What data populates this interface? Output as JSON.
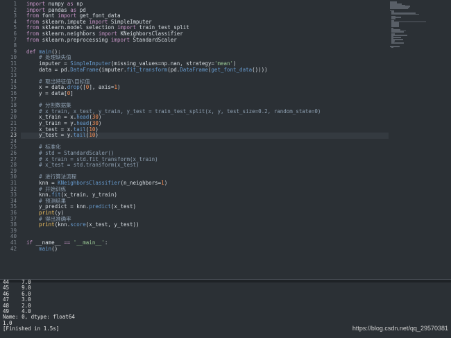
{
  "editor": {
    "current_line": 23,
    "lines": [
      {
        "n": "1",
        "t": [
          {
            "c": "kw",
            "v": "import"
          },
          {
            "v": " numpy "
          },
          {
            "c": "kw",
            "v": "as"
          },
          {
            "v": " np"
          }
        ]
      },
      {
        "n": "2",
        "t": [
          {
            "c": "kw",
            "v": "import"
          },
          {
            "v": " pandas "
          },
          {
            "c": "kw",
            "v": "as"
          },
          {
            "v": " pd"
          }
        ]
      },
      {
        "n": "3",
        "t": [
          {
            "c": "kw",
            "v": "from"
          },
          {
            "v": " font "
          },
          {
            "c": "kw",
            "v": "import"
          },
          {
            "v": " get_font_data"
          }
        ]
      },
      {
        "n": "4",
        "t": [
          {
            "c": "kw",
            "v": "from"
          },
          {
            "v": " sklearn.impute "
          },
          {
            "c": "kw",
            "v": "import"
          },
          {
            "v": " SimpleImputer"
          }
        ]
      },
      {
        "n": "5",
        "t": [
          {
            "c": "kw",
            "v": "from"
          },
          {
            "v": " sklearn.model_selection "
          },
          {
            "c": "kw",
            "v": "import"
          },
          {
            "v": " train_test_split"
          }
        ]
      },
      {
        "n": "6",
        "t": [
          {
            "c": "kw",
            "v": "from"
          },
          {
            "v": " sklearn.neighbors "
          },
          {
            "c": "kw",
            "v": "import"
          },
          {
            "v": " KNeighborsClassifier"
          }
        ]
      },
      {
        "n": "7",
        "t": [
          {
            "c": "kw",
            "v": "from"
          },
          {
            "v": " sklearn.preprocessing "
          },
          {
            "c": "kw",
            "v": "import"
          },
          {
            "v": " StandardScaler"
          }
        ]
      },
      {
        "n": "8",
        "t": []
      },
      {
        "n": "9",
        "t": [
          {
            "c": "kw",
            "v": "def"
          },
          {
            "v": " "
          },
          {
            "c": "fn",
            "v": "main"
          },
          {
            "v": "():"
          }
        ]
      },
      {
        "n": "10",
        "t": [
          {
            "v": "    "
          },
          {
            "c": "cm",
            "v": "# 处理缺失值"
          }
        ]
      },
      {
        "n": "11",
        "t": [
          {
            "v": "    imputer = "
          },
          {
            "c": "fn",
            "v": "SimpleImputer"
          },
          {
            "v": "(missing_values=np.nan, strategy="
          },
          {
            "c": "st",
            "v": "'mean'"
          },
          {
            "v": ")"
          }
        ]
      },
      {
        "n": "12",
        "t": [
          {
            "v": "    data = pd."
          },
          {
            "c": "fn",
            "v": "DataFrame"
          },
          {
            "v": "(imputer."
          },
          {
            "c": "fn",
            "v": "fit_transform"
          },
          {
            "v": "(pd."
          },
          {
            "c": "fn",
            "v": "DataFrame"
          },
          {
            "v": "("
          },
          {
            "c": "fn",
            "v": "get_font_data"
          },
          {
            "v": "())))"
          }
        ]
      },
      {
        "n": "13",
        "t": []
      },
      {
        "n": "14",
        "t": [
          {
            "v": "    "
          },
          {
            "c": "cm",
            "v": "# 取出特征值\\目标值"
          }
        ]
      },
      {
        "n": "15",
        "t": [
          {
            "v": "    x = data."
          },
          {
            "c": "fn",
            "v": "drop"
          },
          {
            "v": "(["
          },
          {
            "c": "nm",
            "v": "0"
          },
          {
            "v": "], axis="
          },
          {
            "c": "nm",
            "v": "1"
          },
          {
            "v": ")"
          }
        ]
      },
      {
        "n": "16",
        "t": [
          {
            "v": "    y = data["
          },
          {
            "c": "nm",
            "v": "0"
          },
          {
            "v": "]"
          }
        ]
      },
      {
        "n": "17",
        "t": []
      },
      {
        "n": "18",
        "t": [
          {
            "v": "    "
          },
          {
            "c": "cm",
            "v": "# 分割数据集"
          }
        ]
      },
      {
        "n": "19",
        "t": [
          {
            "v": "    "
          },
          {
            "c": "cm",
            "v": "# x_train, x_test, y_train, y_test = train_test_split(x, y, test_size=0.2, random_state=0)"
          }
        ]
      },
      {
        "n": "20",
        "t": [
          {
            "v": "    x_train = x."
          },
          {
            "c": "fn",
            "v": "head"
          },
          {
            "v": "("
          },
          {
            "c": "nm",
            "v": "30"
          },
          {
            "v": ")"
          }
        ]
      },
      {
        "n": "21",
        "t": [
          {
            "v": "    y_train = y."
          },
          {
            "c": "fn",
            "v": "head"
          },
          {
            "v": "("
          },
          {
            "c": "nm",
            "v": "30"
          },
          {
            "v": ")"
          }
        ]
      },
      {
        "n": "22",
        "t": [
          {
            "v": "    x_test = x."
          },
          {
            "c": "fn",
            "v": "tail"
          },
          {
            "v": "("
          },
          {
            "c": "nm",
            "v": "10"
          },
          {
            "v": ")"
          }
        ]
      },
      {
        "n": "23",
        "t": [
          {
            "v": "    y_test = y."
          },
          {
            "c": "fn",
            "v": "tail"
          },
          {
            "v": "("
          },
          {
            "c": "nm",
            "v": "10"
          },
          {
            "v": ")"
          }
        ]
      },
      {
        "n": "24",
        "t": []
      },
      {
        "n": "25",
        "t": [
          {
            "v": "    "
          },
          {
            "c": "cm",
            "v": "# 标准化"
          }
        ]
      },
      {
        "n": "26",
        "t": [
          {
            "v": "    "
          },
          {
            "c": "cm",
            "v": "# std = StandardScaler()"
          }
        ]
      },
      {
        "n": "27",
        "t": [
          {
            "v": "    "
          },
          {
            "c": "cm",
            "v": "# x_train = std.fit_transform(x_train)"
          }
        ]
      },
      {
        "n": "28",
        "t": [
          {
            "v": "    "
          },
          {
            "c": "cm",
            "v": "# x_test = std.transform(x_test)"
          }
        ]
      },
      {
        "n": "29",
        "t": []
      },
      {
        "n": "30",
        "t": [
          {
            "v": "    "
          },
          {
            "c": "cm",
            "v": "# 进行算法流程"
          }
        ]
      },
      {
        "n": "31",
        "t": [
          {
            "v": "    knn = "
          },
          {
            "c": "fn",
            "v": "KNeighborsClassifier"
          },
          {
            "v": "(n_neighbors="
          },
          {
            "c": "nm",
            "v": "1"
          },
          {
            "v": ")"
          }
        ]
      },
      {
        "n": "32",
        "t": [
          {
            "v": "    "
          },
          {
            "c": "cm",
            "v": "# 开始训练"
          }
        ]
      },
      {
        "n": "33",
        "t": [
          {
            "v": "    knn."
          },
          {
            "c": "fn",
            "v": "fit"
          },
          {
            "v": "(x_train, y_train)"
          }
        ]
      },
      {
        "n": "34",
        "t": [
          {
            "v": "    "
          },
          {
            "c": "cm",
            "v": "# 预测结果"
          }
        ]
      },
      {
        "n": "35",
        "t": [
          {
            "v": "    y_predict = knn."
          },
          {
            "c": "fn",
            "v": "predict"
          },
          {
            "v": "(x_test)"
          }
        ]
      },
      {
        "n": "36",
        "t": [
          {
            "v": "    "
          },
          {
            "c": "bi",
            "v": "print"
          },
          {
            "v": "(y)"
          }
        ]
      },
      {
        "n": "37",
        "t": [
          {
            "v": "    "
          },
          {
            "c": "cm",
            "v": "# 得出准确率"
          }
        ]
      },
      {
        "n": "38",
        "t": [
          {
            "v": "    "
          },
          {
            "c": "bi",
            "v": "print"
          },
          {
            "v": "(knn."
          },
          {
            "c": "fn",
            "v": "score"
          },
          {
            "v": "(x_test, y_test))"
          }
        ]
      },
      {
        "n": "39",
        "t": []
      },
      {
        "n": "40",
        "t": []
      },
      {
        "n": "41",
        "t": [
          {
            "c": "kw",
            "v": "if"
          },
          {
            "v": " __name__ "
          },
          {
            "c": "kw",
            "v": "=="
          },
          {
            "v": " "
          },
          {
            "c": "st",
            "v": "'__main__'"
          },
          {
            "v": ":"
          }
        ]
      },
      {
        "n": "42",
        "t": [
          {
            "v": "    "
          },
          {
            "c": "fn",
            "v": "main"
          },
          {
            "v": "()"
          }
        ]
      }
    ]
  },
  "console": {
    "lines": [
      "44    7.0",
      "45    9.0",
      "46    6.0",
      "47    3.0",
      "48    2.0",
      "49    4.0",
      "Name: 0, dtype: float64",
      "1.0",
      "[Finished in 1.5s]"
    ]
  },
  "watermark": "https://blog.csdn.net/qq_29570381"
}
